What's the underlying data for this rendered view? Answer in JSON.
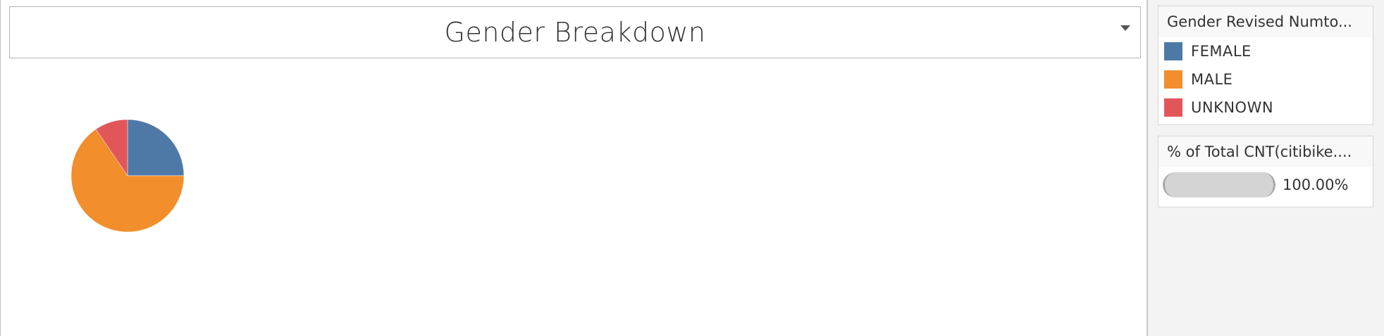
{
  "chart_data": {
    "type": "pie",
    "title": "Gender Breakdown",
    "slices": [
      {
        "label": "FEMALE",
        "value": 25.0,
        "color": "#4e79a7"
      },
      {
        "label": "MALE",
        "value": 65.5,
        "color": "#f28e2b"
      },
      {
        "label": "UNKNOWN",
        "value": 9.5,
        "color": "#e15759"
      }
    ]
  },
  "legend": {
    "title": "Gender Revised Numto...",
    "items": [
      {
        "label": "FEMALE",
        "color": "#4e79a7"
      },
      {
        "label": "MALE",
        "color": "#f28e2b"
      },
      {
        "label": "UNKNOWN",
        "color": "#e15759"
      }
    ]
  },
  "size_legend": {
    "title": "% of Total CNT(citibike....",
    "value_label": "100.00%"
  }
}
